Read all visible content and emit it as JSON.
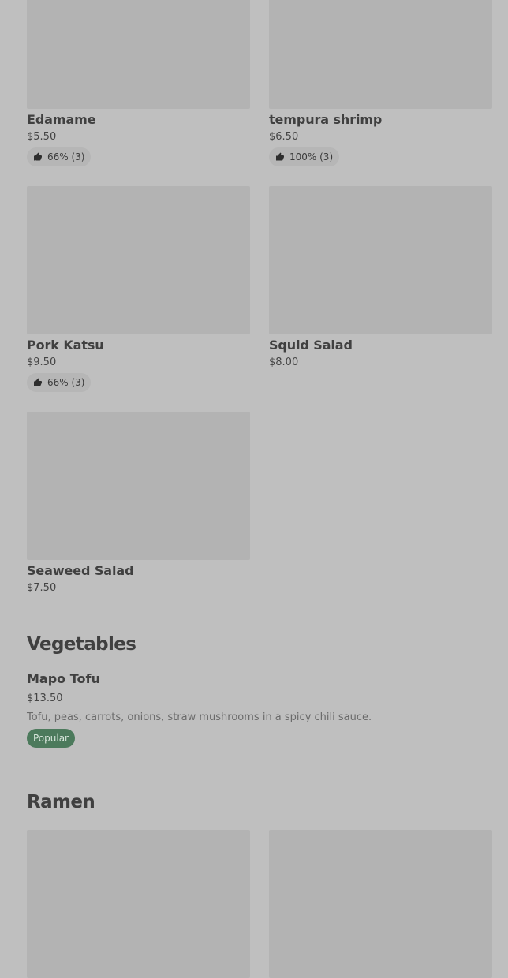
{
  "grid_items": [
    {
      "name": "Edamame",
      "price": "$5.50",
      "rating": "66% (3)"
    },
    {
      "name": "tempura shrimp",
      "price": "$6.50",
      "rating": "100% (3)"
    },
    {
      "name": "Pork Katsu",
      "price": "$9.50",
      "rating": "66% (3)"
    },
    {
      "name": "Squid Salad",
      "price": "$8.00"
    },
    {
      "name": "Seaweed Salad",
      "price": "$7.50"
    }
  ],
  "vegetables": {
    "title": "Vegetables",
    "items": [
      {
        "name": "Mapo Tofu",
        "price": "$13.50",
        "description": "Tofu, peas, carrots, onions, straw mushrooms in a spicy chili sauce.",
        "badge": "Popular"
      }
    ]
  },
  "ramen": {
    "title": "Ramen"
  },
  "colors": {
    "background": "#bfbfbf",
    "thumbnail": "#b3b3b3",
    "popular_badge": "#4c7a5c"
  },
  "icons": {
    "rating": "thumbs-up-icon"
  }
}
